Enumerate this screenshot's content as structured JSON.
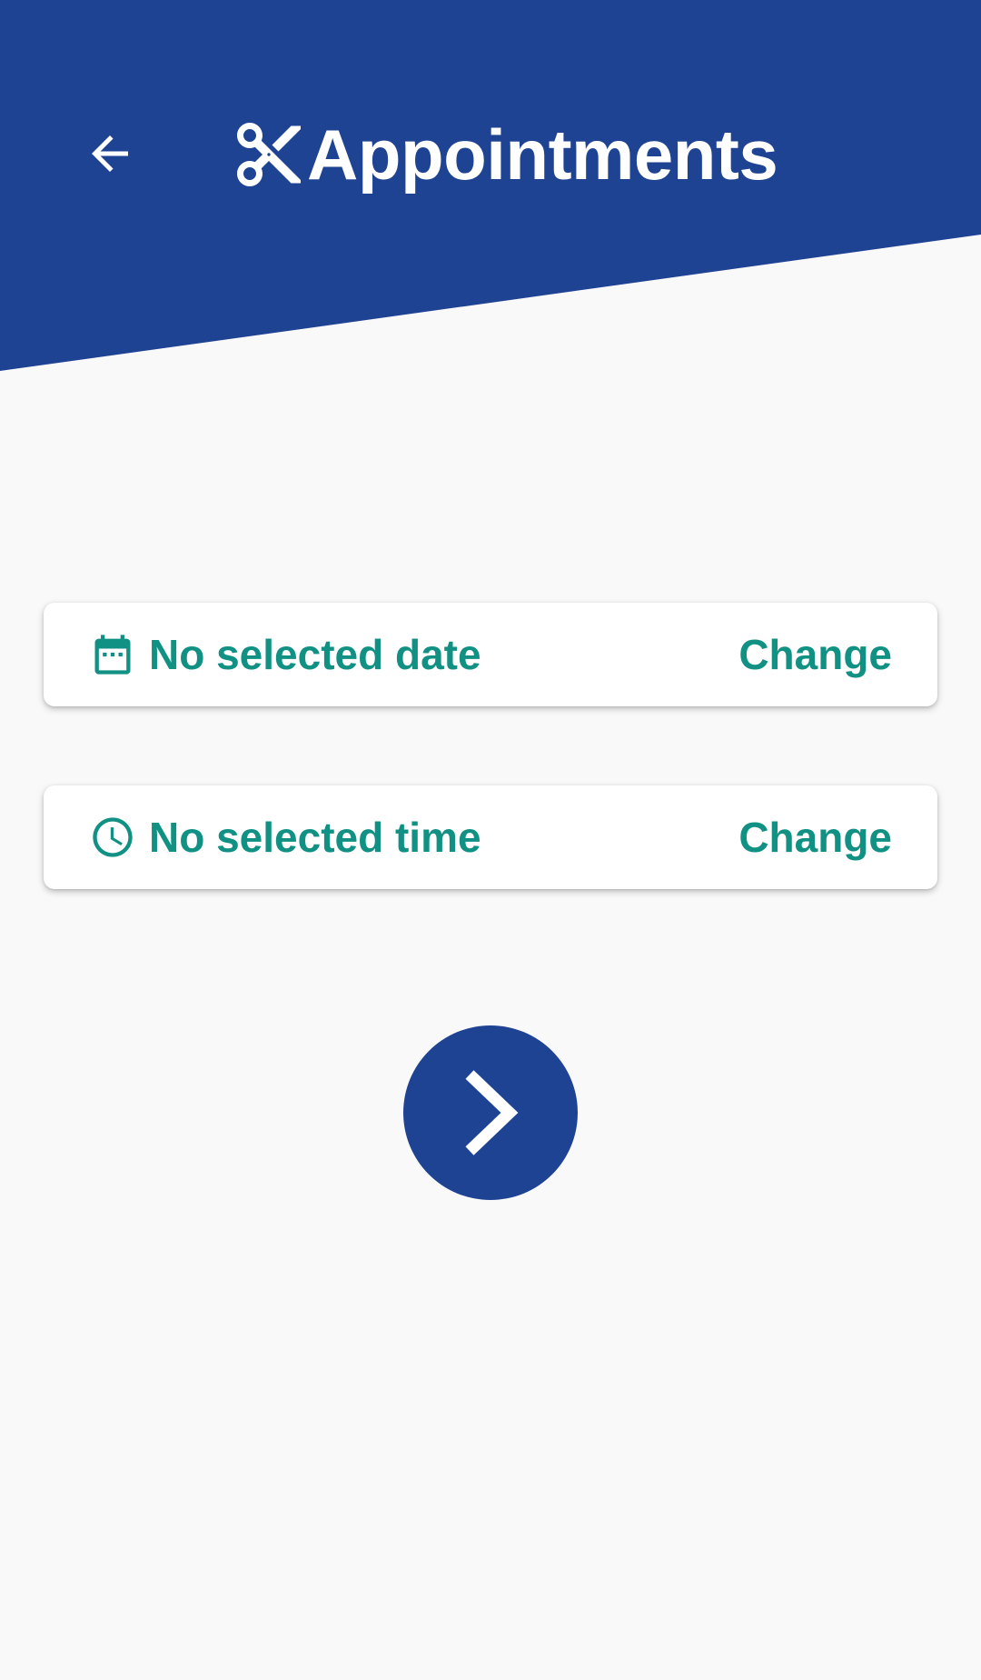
{
  "header": {
    "title": "Appointments",
    "back_icon": "arrow-left-icon",
    "title_icon": "scissors-icon",
    "background_color": "#1f4393"
  },
  "date_card": {
    "icon": "calendar-icon",
    "label": "No selected date",
    "action_label": "Change"
  },
  "time_card": {
    "icon": "clock-icon",
    "label": "No selected time",
    "action_label": "Change"
  },
  "next_button": {
    "icon": "chevron-right-icon",
    "color": "#1f4393"
  },
  "colors": {
    "accent": "#119183",
    "background": "#f9f9f9",
    "primary": "#1f4393"
  }
}
